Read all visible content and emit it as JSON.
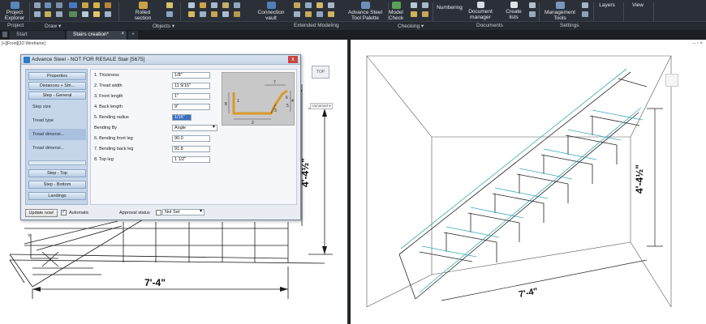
{
  "ribbon": {
    "project_explorer": "Project\nExplorer",
    "rolled_section": "Rolled\nsection",
    "connection_vault": "Connection\nvault",
    "tool_palette": "Advance Steel\nTool Palette",
    "model_check": "Model\nCheck",
    "numbering": "Numbering",
    "document_manager": "Document\nmanager",
    "create_lists": "Create\nlists",
    "management_tools": "Management\nTools",
    "layers": "Layers",
    "view": "View"
  },
  "panels": [
    "Project",
    "Draw ▾",
    "Objects ▾",
    "Extended Modeling",
    "Checking ▾",
    "Documents",
    "Settings"
  ],
  "tabs": {
    "start": "Start",
    "active": "Stairs creation*",
    "plus": "+"
  },
  "viewport": {
    "left_title": "[+][Front][2D Wireframe]"
  },
  "viewcube": {
    "face": "TOP",
    "unnamed": "Unnamed ▾"
  },
  "dialog": {
    "title": "Advance Steel - NOT FOR RESALE   Stair [5675]",
    "close": "x",
    "nav_heads": [
      "Properties",
      "Distances + Stri..."
    ],
    "nav_group1": "Step - General",
    "nav_items": [
      "Step size",
      "Tread type",
      "Tread dimensi...",
      "Tread dimensi..."
    ],
    "nav_heads2": [
      "Step - Top",
      "Step - Bottom",
      "Landings"
    ],
    "fields": [
      {
        "label": "1. Thickness",
        "value": "1/8\""
      },
      {
        "label": "2. Tread width",
        "value": "11 9/16\""
      },
      {
        "label": "3. Front length",
        "value": "1\""
      },
      {
        "label": "4. Back length",
        "value": "9\""
      },
      {
        "label": "5. Bending radius",
        "value": "1/16\""
      },
      {
        "label": "Bending By",
        "value": "Angle"
      },
      {
        "label": "6. Bending front leg",
        "value": "90.0"
      },
      {
        "label": "7. Bending back leg",
        "value": "91.8"
      },
      {
        "label": "8. Top leg",
        "value": "1 1/2\""
      }
    ],
    "diagram_labels": [
      "7",
      "6",
      "5",
      "4",
      "1",
      "8",
      "2",
      "3"
    ],
    "update_button": "Update now!",
    "automatic_label": "Automatic",
    "approval_label": "Approval status",
    "approval_value": "Not Set"
  },
  "dimensions": {
    "left_height": "4'-4½\"",
    "left_width": "7'-4\"",
    "right_height": "4'-4½\"",
    "right_width": "7'-4\""
  },
  "colors": {
    "ribbon": "#2b3038",
    "accent": "#3b6fc2",
    "drawing_line": "#1a1a1a",
    "cyan_line": "#3aa9b8"
  }
}
